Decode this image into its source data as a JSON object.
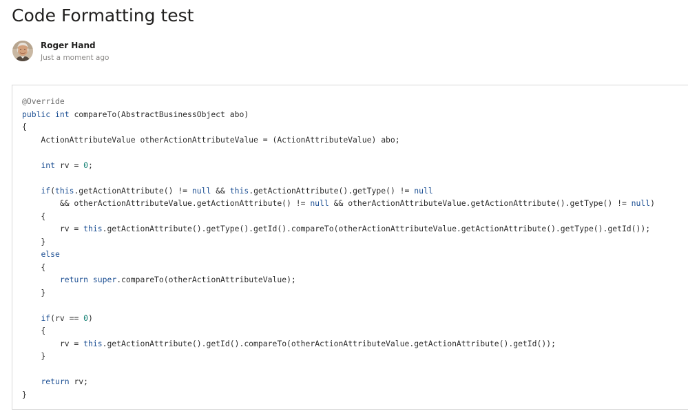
{
  "page": {
    "title": "Code Formatting test"
  },
  "author": {
    "name": "Roger Hand",
    "timestamp": "Just a moment ago"
  },
  "colors": {
    "keyword": "#1c4f93",
    "annotation": "#6e6e6e",
    "number": "#0c7c6f",
    "plain": "#2b2b2b",
    "border": "#d6d6d6"
  },
  "code": {
    "language": "java",
    "lines": [
      [
        {
          "t": "@Override",
          "c": "an"
        }
      ],
      [
        {
          "t": "public",
          "c": "kw"
        },
        {
          "t": " "
        },
        {
          "t": "int",
          "c": "kw"
        },
        {
          "t": " compareTo(AbstractBusinessObject abo)"
        }
      ],
      [
        {
          "t": "{"
        }
      ],
      [
        {
          "t": "    ActionAttributeValue otherActionAttributeValue = (ActionAttributeValue) abo;"
        }
      ],
      [],
      [
        {
          "t": "    "
        },
        {
          "t": "int",
          "c": "kw"
        },
        {
          "t": " rv = "
        },
        {
          "t": "0",
          "c": "num"
        },
        {
          "t": ";"
        }
      ],
      [],
      [
        {
          "t": "    "
        },
        {
          "t": "if",
          "c": "kw"
        },
        {
          "t": "("
        },
        {
          "t": "this",
          "c": "kw"
        },
        {
          "t": ".getActionAttribute() != "
        },
        {
          "t": "null",
          "c": "kw"
        },
        {
          "t": " && "
        },
        {
          "t": "this",
          "c": "kw"
        },
        {
          "t": ".getActionAttribute().getType() != "
        },
        {
          "t": "null",
          "c": "kw"
        }
      ],
      [
        {
          "t": "        && otherActionAttributeValue.getActionAttribute() != "
        },
        {
          "t": "null",
          "c": "kw"
        },
        {
          "t": " && otherActionAttributeValue.getActionAttribute().getType() != "
        },
        {
          "t": "null",
          "c": "kw"
        },
        {
          "t": ")"
        }
      ],
      [
        {
          "t": "    {"
        }
      ],
      [
        {
          "t": "        rv = "
        },
        {
          "t": "this",
          "c": "kw"
        },
        {
          "t": ".getActionAttribute().getType().getId().compareTo(otherActionAttributeValue.getActionAttribute().getType().getId());"
        }
      ],
      [
        {
          "t": "    }"
        }
      ],
      [
        {
          "t": "    "
        },
        {
          "t": "else",
          "c": "kw"
        }
      ],
      [
        {
          "t": "    {"
        }
      ],
      [
        {
          "t": "        "
        },
        {
          "t": "return",
          "c": "kw"
        },
        {
          "t": " "
        },
        {
          "t": "super",
          "c": "kw"
        },
        {
          "t": ".compareTo(otherActionAttributeValue);"
        }
      ],
      [
        {
          "t": "    }"
        }
      ],
      [],
      [
        {
          "t": "    "
        },
        {
          "t": "if",
          "c": "kw"
        },
        {
          "t": "(rv == "
        },
        {
          "t": "0",
          "c": "num"
        },
        {
          "t": ")"
        }
      ],
      [
        {
          "t": "    {"
        }
      ],
      [
        {
          "t": "        rv = "
        },
        {
          "t": "this",
          "c": "kw"
        },
        {
          "t": ".getActionAttribute().getId().compareTo(otherActionAttributeValue.getActionAttribute().getId());"
        }
      ],
      [
        {
          "t": "    }"
        }
      ],
      [],
      [
        {
          "t": "    "
        },
        {
          "t": "return",
          "c": "kw"
        },
        {
          "t": " rv;"
        }
      ],
      [
        {
          "t": "}"
        }
      ]
    ]
  }
}
